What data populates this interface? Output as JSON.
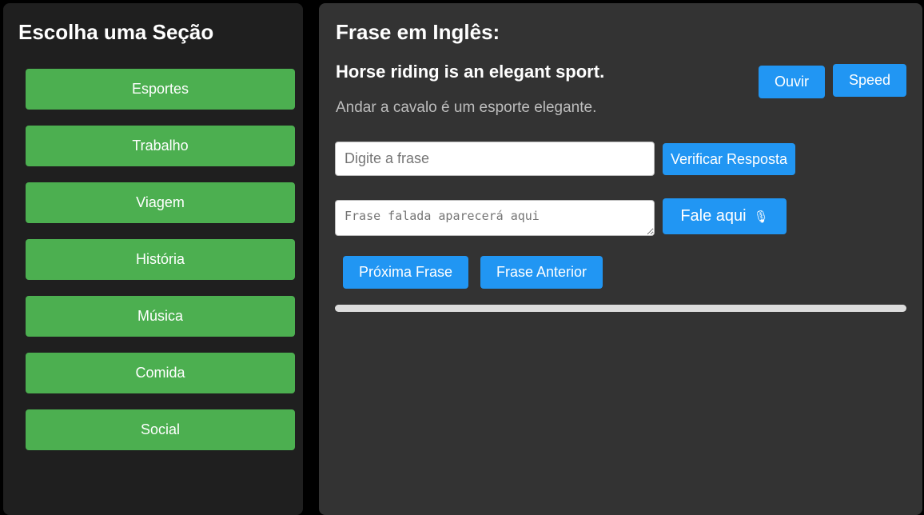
{
  "sidebar": {
    "title": "Escolha uma Seção",
    "sections": [
      {
        "label": "Esportes"
      },
      {
        "label": "Trabalho"
      },
      {
        "label": "Viagem"
      },
      {
        "label": "História"
      },
      {
        "label": "Música"
      },
      {
        "label": "Comida"
      },
      {
        "label": "Social"
      }
    ],
    "button_color": "#4caf50"
  },
  "main": {
    "title": "Frase em Inglês:",
    "english_sentence": "Horse riding is an elegant sport.",
    "translation": "Andar a cavalo é um esporte elegante.",
    "listen_label": "Ouvir",
    "speed_label": "Speed",
    "answer_input": {
      "value": "",
      "placeholder": "Digite a frase"
    },
    "verify_label": "Verificar Resposta",
    "speech_area": {
      "value": "",
      "placeholder": "Frase falada aparecerá aqui"
    },
    "speak_label": "Fale aqui",
    "speak_icon": "microphone-icon",
    "next_label": "Próxima Frase",
    "prev_label": "Frase Anterior",
    "progress_fraction": 0,
    "accent_color": "#2196f3",
    "panel_color": "#333333"
  }
}
